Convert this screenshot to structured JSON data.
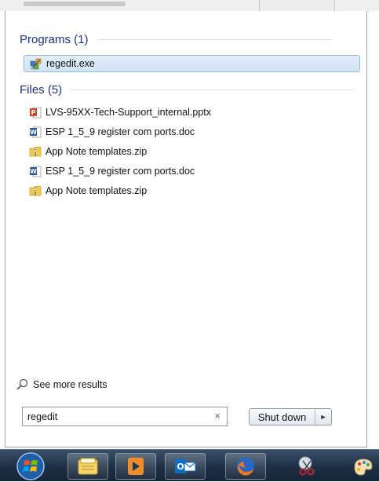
{
  "programs": {
    "title": "Programs (1)",
    "items": [
      {
        "label": "regedit.exe",
        "icon": "registry-editor-icon"
      }
    ]
  },
  "files": {
    "title": "Files (5)",
    "items": [
      {
        "label": "LVS-95XX-Tech-Support_internal.pptx",
        "icon": "powerpoint-icon"
      },
      {
        "label": "ESP 1_5_9 register com ports.doc",
        "icon": "word-icon"
      },
      {
        "label": "App Note templates.zip",
        "icon": "zip-folder-icon"
      },
      {
        "label": "ESP 1_5_9 register com ports.doc",
        "icon": "word-icon"
      },
      {
        "label": "App Note templates.zip",
        "icon": "zip-folder-icon"
      }
    ]
  },
  "see_more": {
    "label": "See more results"
  },
  "search": {
    "value": "regedit",
    "clear_symbol": "×"
  },
  "shutdown": {
    "label": "Shut down",
    "arrow": "►"
  },
  "taskbar": {
    "items": [
      "start-orb-icon",
      "file-explorer-icon",
      "media-player-icon",
      "outlook-icon",
      "firefox-icon",
      "snipping-tool-icon",
      "paint-icon"
    ]
  },
  "colors": {
    "section_title": "#1e3287",
    "selection": "#d0e3f6",
    "taskbar": "#1d2f44"
  }
}
